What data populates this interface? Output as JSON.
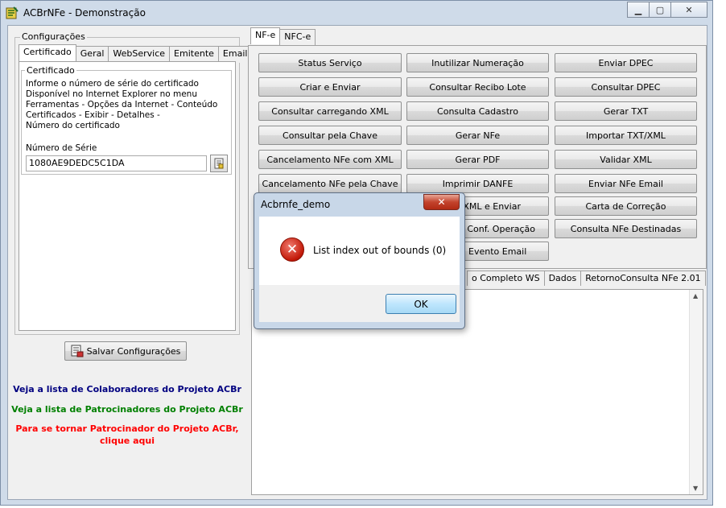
{
  "window": {
    "title": "ACBrNFe - Demonstração"
  },
  "left": {
    "group_title": "Configurações",
    "tabs": [
      "Certificado",
      "Geral",
      "WebService",
      "Emitente",
      "Email"
    ],
    "cert_group_title": "Certificado",
    "info_lines": [
      "Informe o número de série do certificado",
      "Disponível no Internet Explorer no menu",
      "Ferramentas - Opções da Internet - Conteúdo",
      "Certificados - Exibir - Detalhes -",
      "Número do certificado"
    ],
    "serial_label": "Número de Série",
    "serial_value": "1080AE9DEDC5C1DA",
    "save_button": "Salvar Configurações",
    "link_colaboradores": "Veja a lista de Colaboradores do Projeto ACBr",
    "link_patrocinadores": "Veja a lista de Patrocinadores do Projeto ACBr",
    "link_tornar_line1": "Para se tornar Patrocinador do Projeto ACBr,",
    "link_tornar_line2": "clique aqui",
    "colors": {
      "blue_link": "#000080",
      "green_link": "#008000",
      "red_link": "#ff0000"
    }
  },
  "right": {
    "tabs": [
      "NF-e",
      "NFC-e"
    ],
    "buttons_col1": [
      "Status Serviço",
      "Criar e Enviar",
      "Consultar carregando XML",
      "Consultar pela Chave",
      "Cancelamento NFe com XML",
      "Cancelamento NFe pela Chave"
    ],
    "buttons_col2": [
      "Inutilizar Numeração",
      "Consultar Recibo Lote",
      "Consulta Cadastro",
      "Gerar NFe",
      "Gerar PDF",
      "Imprimir DANFE",
      "XML e Enviar",
      "- Conf. Operação",
      "Evento Email"
    ],
    "buttons_col3": [
      "Enviar DPEC",
      "Consultar DPEC",
      "Gerar TXT",
      "Importar TXT/XML",
      "Validar XML",
      "Enviar NFe Email",
      "Carta de Correção",
      "Consulta NFe Destinadas"
    ],
    "lower_tabs": [
      "o Completo WS",
      "Dados",
      "RetornoConsulta NFe 2.01"
    ]
  },
  "dialog": {
    "title": "Acbrnfe_demo",
    "close_glyph": "✕",
    "message": "List index out of bounds (0)",
    "ok": "OK"
  },
  "icons": [
    "app-icon",
    "minimize-icon",
    "maximize-icon",
    "close-icon",
    "browse-cert-icon",
    "save-config-icon",
    "error-icon"
  ]
}
